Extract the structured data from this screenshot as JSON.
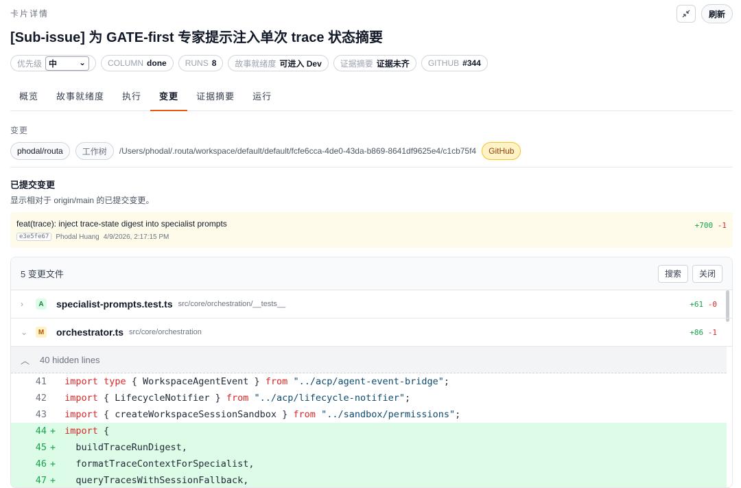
{
  "header": {
    "kicker": "卡片详情",
    "title": "[Sub-issue] 为 GATE-first 专家提示注入单次 trace 状态摘要",
    "refresh_label": "刷新",
    "collapse_icon": "collapse-arrows-icon"
  },
  "chips": {
    "priority_label": "优先级",
    "priority_value": "中",
    "column_label": "COLUMN",
    "column_value": "done",
    "runs_label": "RUNS",
    "runs_value": "8",
    "story_label": "故事就绪度",
    "story_value": "可进入 Dev",
    "evidence_label": "证据摘要",
    "evidence_value": "证据未齐",
    "github_label": "GITHUB",
    "github_value": "#344"
  },
  "tabs": [
    "概览",
    "故事就绪度",
    "执行",
    "变更",
    "证据摘要",
    "运行"
  ],
  "changes": {
    "section_label": "变更",
    "repo": "phodal/routa",
    "worktree_label": "工作树",
    "path": "/Users/phodal/.routa/workspace/default/default/fcfe6cca-4de0-43da-b869-8641df9625e4/c1cb75f4",
    "github_label": "GitHub",
    "committed_title": "已提交变更",
    "committed_desc": "显示相对于 origin/main 的已提交变更。"
  },
  "commit": {
    "message": "feat(trace): inject trace-state digest into specialist prompts",
    "hash": "e3e5fe67",
    "author": "Phodal Huang",
    "date": "4/9/2026, 2:17:15 PM",
    "additions": "+700",
    "deletions": "-1"
  },
  "files_panel": {
    "count_label": "5 变更文件",
    "search_label": "搜索",
    "close_label": "关闭",
    "files": [
      {
        "status": "A",
        "name": "specialist-prompts.test.ts",
        "dir": "src/core/orchestration/__tests__",
        "additions": "+61",
        "deletions": "-0",
        "chevron": ">"
      },
      {
        "status": "M",
        "name": "orchestrator.ts",
        "dir": "src/core/orchestration",
        "additions": "+86",
        "deletions": "-1",
        "chevron": "v"
      }
    ],
    "hidden_lines": "40 hidden lines"
  },
  "diff_lines": [
    {
      "ln": "41",
      "mk": "",
      "text": "import type { WorkspaceAgentEvent } from \"../acp/agent-event-bridge\";"
    },
    {
      "ln": "42",
      "mk": "",
      "text": "import { LifecycleNotifier } from \"../acp/lifecycle-notifier\";"
    },
    {
      "ln": "43",
      "mk": "",
      "text": "import { createWorkspaceSessionSandbox } from \"../sandbox/permissions\";"
    },
    {
      "ln": "44",
      "mk": "+",
      "text": "import {"
    },
    {
      "ln": "45",
      "mk": "+",
      "text": "  buildTraceRunDigest,"
    },
    {
      "ln": "46",
      "mk": "+",
      "text": "  formatTraceContextForSpecialist,"
    },
    {
      "ln": "47",
      "mk": "+",
      "text": "  queryTracesWithSessionFallback,"
    }
  ]
}
